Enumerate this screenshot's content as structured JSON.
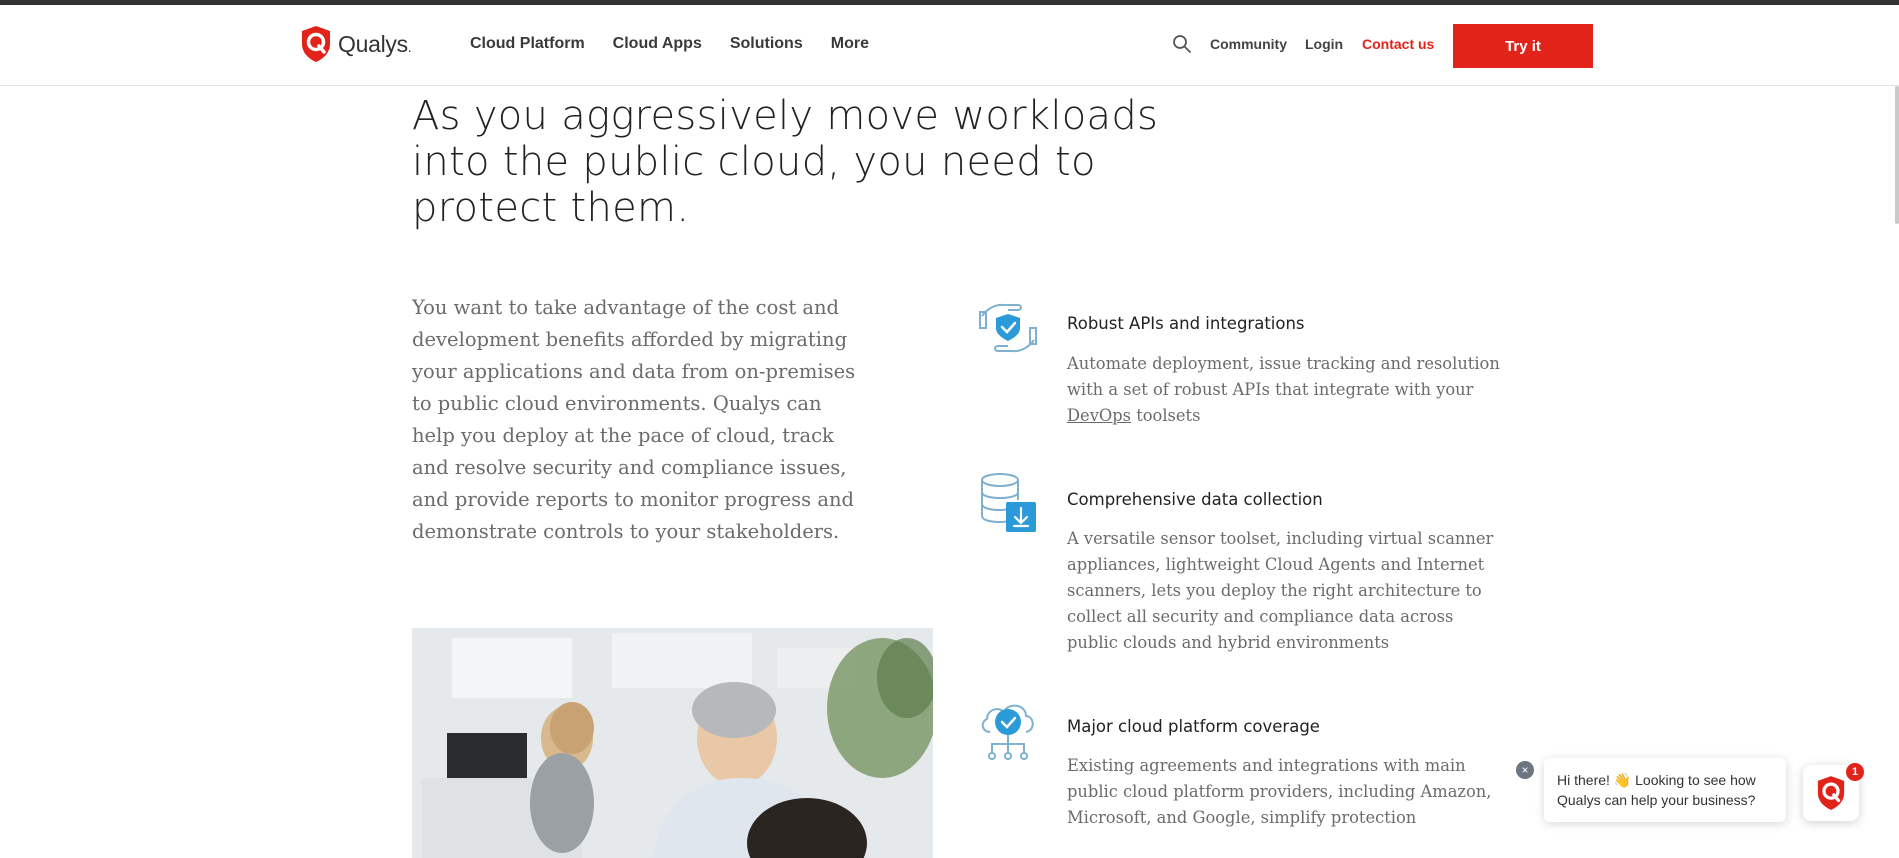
{
  "brand": {
    "name": "Qualys",
    "suffix": ".",
    "accent_color": "#e2231a"
  },
  "nav": {
    "items": [
      {
        "label": "Cloud Platform"
      },
      {
        "label": "Cloud Apps"
      },
      {
        "label": "Solutions"
      },
      {
        "label": "More"
      }
    ],
    "search_icon": "search-icon",
    "community": "Community",
    "login": "Login",
    "contact": "Contact us",
    "cta": "Try it"
  },
  "hero": {
    "headline_line1": "As you aggressively move workloads",
    "headline_line2": "into the public cloud, you need to",
    "headline_line3": "protect them."
  },
  "intro": {
    "paragraph": "You want to take advantage of the cost and development benefits afforded by migrating your applications and data from on-premises to public cloud environments. Qualys can help you deploy at the pace of cloud, track and resolve security and compliance issues, and provide reports to monitor progress and demonstrate controls to your stakeholders."
  },
  "features": [
    {
      "title": "Robust APIs and integrations",
      "desc_before_link": "Automate deployment, issue tracking and resolution with a set of robust APIs that integrate with your ",
      "link": "DevOps",
      "desc_after_link": " toolsets",
      "icon": "shield-hands-icon"
    },
    {
      "title": "Comprehensive data collection",
      "desc": "A versatile sensor toolset, including virtual scanner appliances, lightweight Cloud Agents and Internet scanners, lets you deploy the right architecture to collect all security and compliance data across public clouds and hybrid environments",
      "icon": "database-download-icon"
    },
    {
      "title": "Major cloud platform coverage",
      "desc": "Existing agreements and integrations with main public cloud platform providers, including Amazon, Microsoft, and Google, simplify protection",
      "icon": "cloud-check-icon"
    }
  ],
  "chat": {
    "message_line1": "Hi there! 👋 Looking to see how",
    "message_line2": "Qualys can help your business?",
    "badge_count": "1",
    "close_label": "×"
  }
}
